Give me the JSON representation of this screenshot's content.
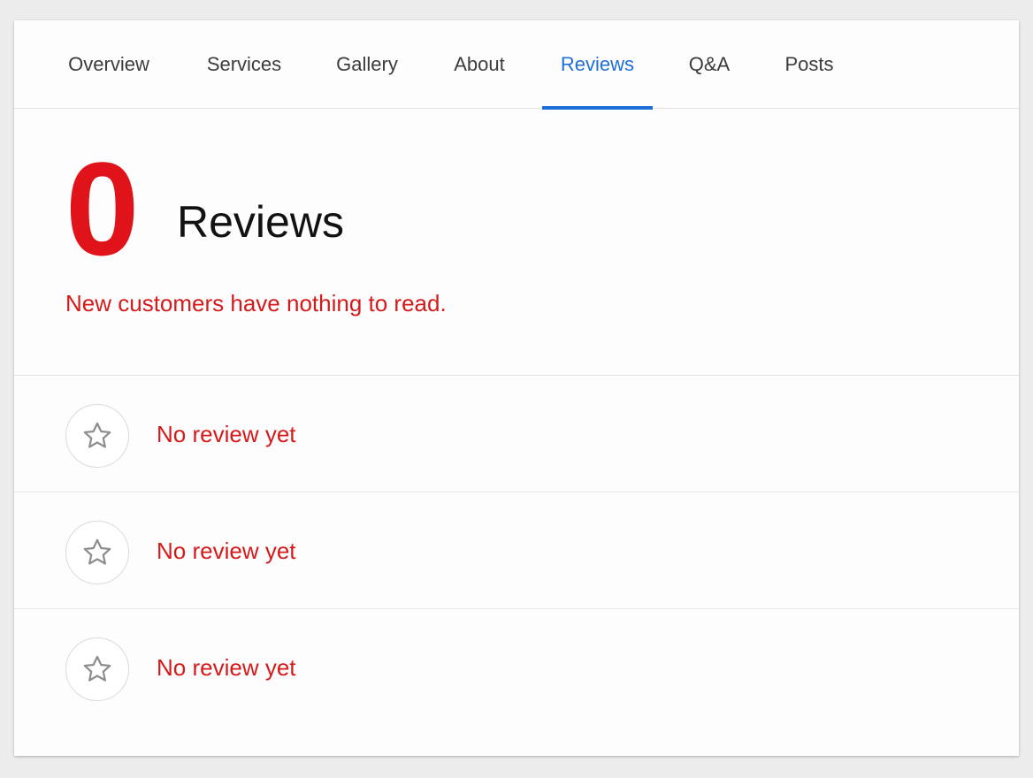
{
  "tabs": [
    {
      "label": "Overview",
      "active": false
    },
    {
      "label": "Services",
      "active": false
    },
    {
      "label": "Gallery",
      "active": false
    },
    {
      "label": "About",
      "active": false
    },
    {
      "label": "Reviews",
      "active": true
    },
    {
      "label": "Q&A",
      "active": false
    },
    {
      "label": "Posts",
      "active": false
    }
  ],
  "summary": {
    "count": "0",
    "title": "Reviews",
    "message": "New customers have nothing to read."
  },
  "reviews": [
    {
      "icon": "star-outline-icon",
      "text": "No review yet"
    },
    {
      "icon": "star-outline-icon",
      "text": "No review yet"
    },
    {
      "icon": "star-outline-icon",
      "text": "No review yet"
    }
  ],
  "colors": {
    "accent": "#1f6fd9",
    "alert": "#e0131a",
    "alert_text": "#d41a1a",
    "background": "#ececec",
    "card": "#fdfdfd"
  }
}
